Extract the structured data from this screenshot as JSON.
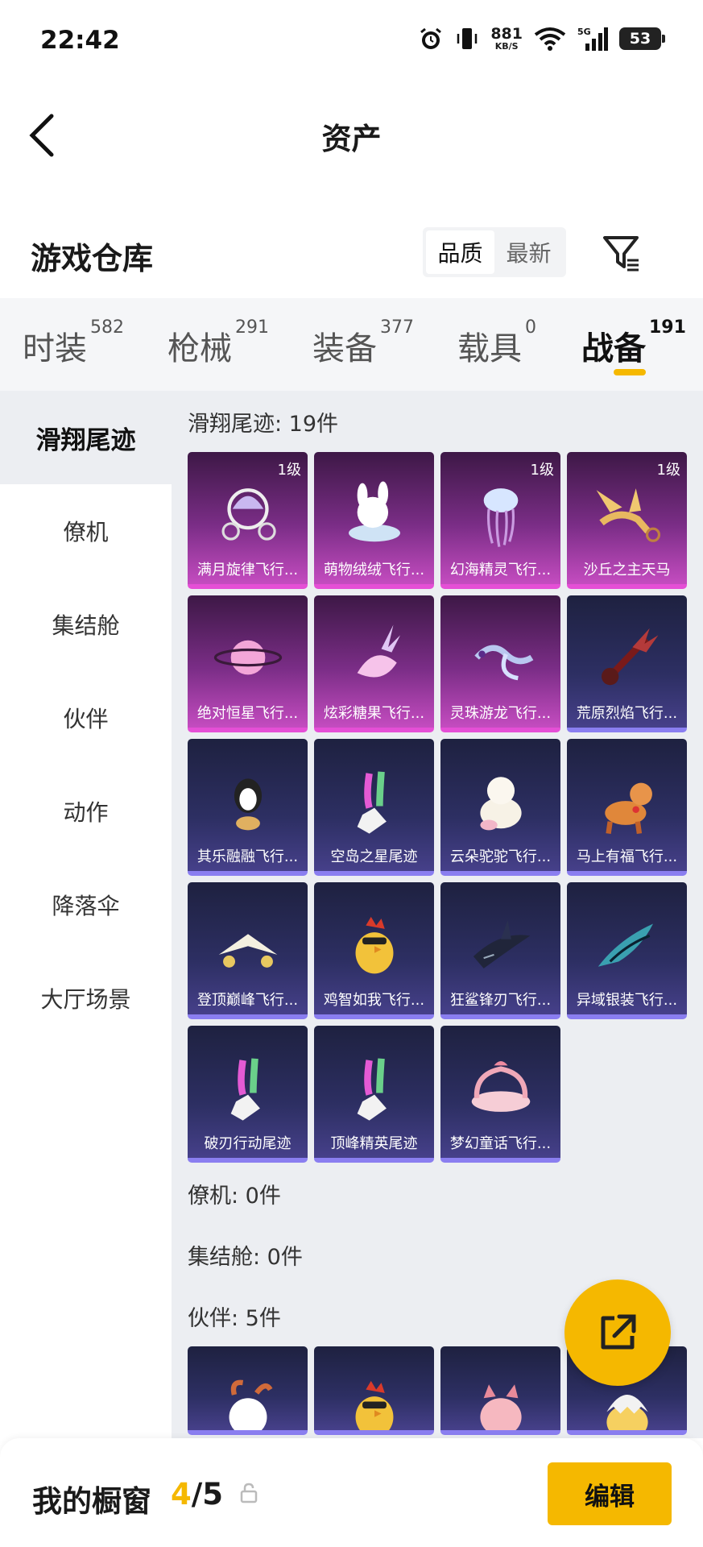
{
  "status_bar": {
    "time": "22:42",
    "net_speed": "881",
    "net_unit": "KB/S",
    "signal_label": "5G",
    "battery": "53"
  },
  "header": {
    "title": "资产"
  },
  "warehouse": {
    "title": "游戏仓库",
    "sort_options": [
      "品质",
      "最新"
    ],
    "active_sort": "品质"
  },
  "category_tabs": [
    {
      "label": "时装",
      "count": "582"
    },
    {
      "label": "枪械",
      "count": "291"
    },
    {
      "label": "装备",
      "count": "377"
    },
    {
      "label": "载具",
      "count": "0"
    },
    {
      "label": "战备",
      "count": "191",
      "active": true
    }
  ],
  "sidebar": {
    "items": [
      "滑翔尾迹",
      "僚机",
      "集结舱",
      "伙伴",
      "动作",
      "降落伞",
      "大厅场景"
    ],
    "active": "滑翔尾迹"
  },
  "sections": {
    "glide": {
      "title": "滑翔尾迹: 19件",
      "items": [
        {
          "name": "满月旋律飞行...",
          "level": "1级",
          "rarity": "purple",
          "icon": "carriage-icon"
        },
        {
          "name": "萌物绒绒飞行...",
          "level": "",
          "rarity": "purple",
          "icon": "bunny-icon"
        },
        {
          "name": "幻海精灵飞行...",
          "level": "1级",
          "rarity": "purple",
          "icon": "jellyfish-icon"
        },
        {
          "name": "沙丘之主天马",
          "level": "1级",
          "rarity": "purple",
          "icon": "pegasus-icon"
        },
        {
          "name": "绝对恒星飞行...",
          "level": "",
          "rarity": "purple",
          "icon": "planet-icon"
        },
        {
          "name": "炫彩糖果飞行...",
          "level": "",
          "rarity": "purple",
          "icon": "candy-icon"
        },
        {
          "name": "灵珠游龙飞行...",
          "level": "",
          "rarity": "purple",
          "icon": "dragon-icon"
        },
        {
          "name": "荒原烈焰飞行...",
          "level": "",
          "rarity": "blue",
          "icon": "flame-guitar-icon"
        },
        {
          "name": "其乐融融飞行...",
          "level": "",
          "rarity": "blue",
          "icon": "penguin-icon"
        },
        {
          "name": "空岛之星尾迹",
          "level": "",
          "rarity": "blue",
          "icon": "rainbow-trail-icon"
        },
        {
          "name": "云朵驼驼飞行...",
          "level": "",
          "rarity": "blue",
          "icon": "alpaca-icon"
        },
        {
          "name": "马上有福飞行...",
          "level": "",
          "rarity": "blue",
          "icon": "horse-icon"
        },
        {
          "name": "登顶巅峰飞行...",
          "level": "",
          "rarity": "blue",
          "icon": "jet-icon"
        },
        {
          "name": "鸡智如我飞行...",
          "level": "",
          "rarity": "blue",
          "icon": "chicken-icon"
        },
        {
          "name": "狂鲨锋刃飞行...",
          "level": "",
          "rarity": "blue",
          "icon": "shark-icon"
        },
        {
          "name": "异域银装飞行...",
          "level": "",
          "rarity": "blue",
          "icon": "wing-icon"
        },
        {
          "name": "破刃行动尾迹",
          "level": "",
          "rarity": "blue",
          "icon": "rainbow-trail-icon"
        },
        {
          "name": "顶峰精英尾迹",
          "level": "",
          "rarity": "blue",
          "icon": "rainbow-trail-icon"
        },
        {
          "name": "梦幻童话飞行...",
          "level": "",
          "rarity": "blue",
          "icon": "bed-icon"
        }
      ]
    },
    "wingman": {
      "title": "僚机: 0件"
    },
    "capsule": {
      "title": "集结舱: 0件"
    },
    "partner": {
      "title": "伙伴: 5件",
      "items": [
        {
          "icon": "goat-icon",
          "rarity": "blue"
        },
        {
          "icon": "chicken-icon",
          "rarity": "blue"
        },
        {
          "icon": "pink-creature-icon",
          "rarity": "blue"
        },
        {
          "icon": "egg-chick-icon",
          "rarity": "blue"
        }
      ]
    }
  },
  "bottom_bar": {
    "title": "我的橱窗",
    "current": "4",
    "total": "/5",
    "edit_label": "编辑"
  },
  "colors": {
    "accent": "#f5b800",
    "purple_rarity": "#e54fd6",
    "blue_rarity": "#8a7ef0"
  }
}
